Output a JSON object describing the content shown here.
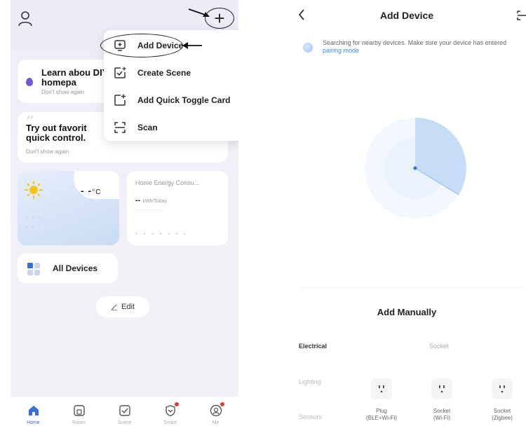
{
  "home": {
    "menu": {
      "add_device": "Add Device",
      "create_scene": "Create Scene",
      "add_quick_toggle": "Add Quick Toggle Card",
      "scan": "Scan"
    },
    "learn_card": {
      "title": "Learn abou DIY homepa",
      "dismiss": "Don't show again"
    },
    "try_card": {
      "title": "Try out favorit quick control.",
      "dismiss": "Don't show again"
    },
    "weather": {
      "temp": "- -",
      "unit": "°C",
      "line1": "- - -",
      "line2": "- - -"
    },
    "energy": {
      "title": "Home Energy Consu...",
      "value": "--",
      "unit": "kWh/Today",
      "dots": "...............",
      "dashes": "- - - - - - -"
    },
    "all_devices": "All Devices",
    "edit": "Edit",
    "tabs": [
      {
        "label": "Home",
        "icon": "home-icon"
      },
      {
        "label": "Room",
        "icon": "room-icon"
      },
      {
        "label": "Scene",
        "icon": "scene-icon"
      },
      {
        "label": "Smart",
        "icon": "smart-icon"
      },
      {
        "label": "Me",
        "icon": "me-icon"
      }
    ]
  },
  "add_device": {
    "title": "Add Device",
    "search_text": "Searching for nearby devices. Make sure your device has entered",
    "pairing_link": "pairing mode",
    "manual_title": "Add Manually",
    "categories": [
      "Electrical",
      "Lighting",
      "Sensors"
    ],
    "subcategory": "Socket",
    "devices": [
      {
        "name": "Plug",
        "detail": "(BLE+Wi-Fi)"
      },
      {
        "name": "Socket",
        "detail": "(Wi-Fi)"
      },
      {
        "name": "Socket",
        "detail": "(Zigbee)"
      }
    ]
  },
  "colors": {
    "accent": "#3a6fd8",
    "link": "#3a8be8",
    "notification": "#e53935",
    "diy_icon": "#6d5bd0"
  }
}
